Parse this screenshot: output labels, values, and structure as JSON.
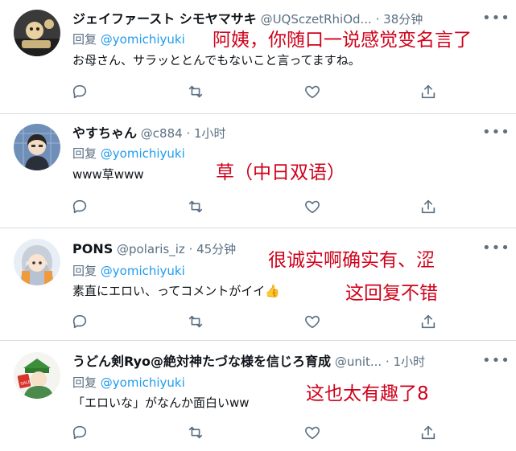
{
  "tweets": [
    {
      "name": "ジェイファースト シモヤマサキ",
      "handle": "@UQSczetRhiOd...",
      "time": "· 38分钟",
      "reply_prefix": "回复",
      "reply_to": "@yomichiyuki",
      "text": "お母さん、サラッととんでもないこと言ってますね。",
      "annotations": [
        "阿姨，你随口一说感觉变名言了"
      ]
    },
    {
      "name": "やすちゃん",
      "handle": "@c884",
      "time": "· 1小时",
      "reply_prefix": "回复",
      "reply_to": "@yomichiyuki",
      "text": "www草www",
      "annotations": [
        "草（中日双语）"
      ]
    },
    {
      "name": "PONS",
      "handle": "@polaris_iz",
      "time": "· 45分钟",
      "reply_prefix": "回复",
      "reply_to": "@yomichiyuki",
      "text": "素直にエロい、ってコメントがイイ👍",
      "annotations": [
        "很诚实啊确实有、涩",
        "这回复不错"
      ]
    },
    {
      "name": "うどん剣Ryo@絶対神たづな様を信じろ育成",
      "handle": "@unit...",
      "time": "· 1小时",
      "reply_prefix": "回复",
      "reply_to": "@yomichiyuki",
      "text": "「エロいな」がなんか面白いww",
      "annotations": [
        "这也太有趣了8"
      ]
    }
  ],
  "icons": {
    "reply": "reply-icon",
    "retweet": "retweet-icon",
    "like": "like-icon",
    "share": "share-icon",
    "more": "more-icon"
  },
  "colors": {
    "link": "#1d9bf0",
    "muted": "#5b7083",
    "annotation": "#d0021b",
    "divider": "#d9dee2"
  }
}
